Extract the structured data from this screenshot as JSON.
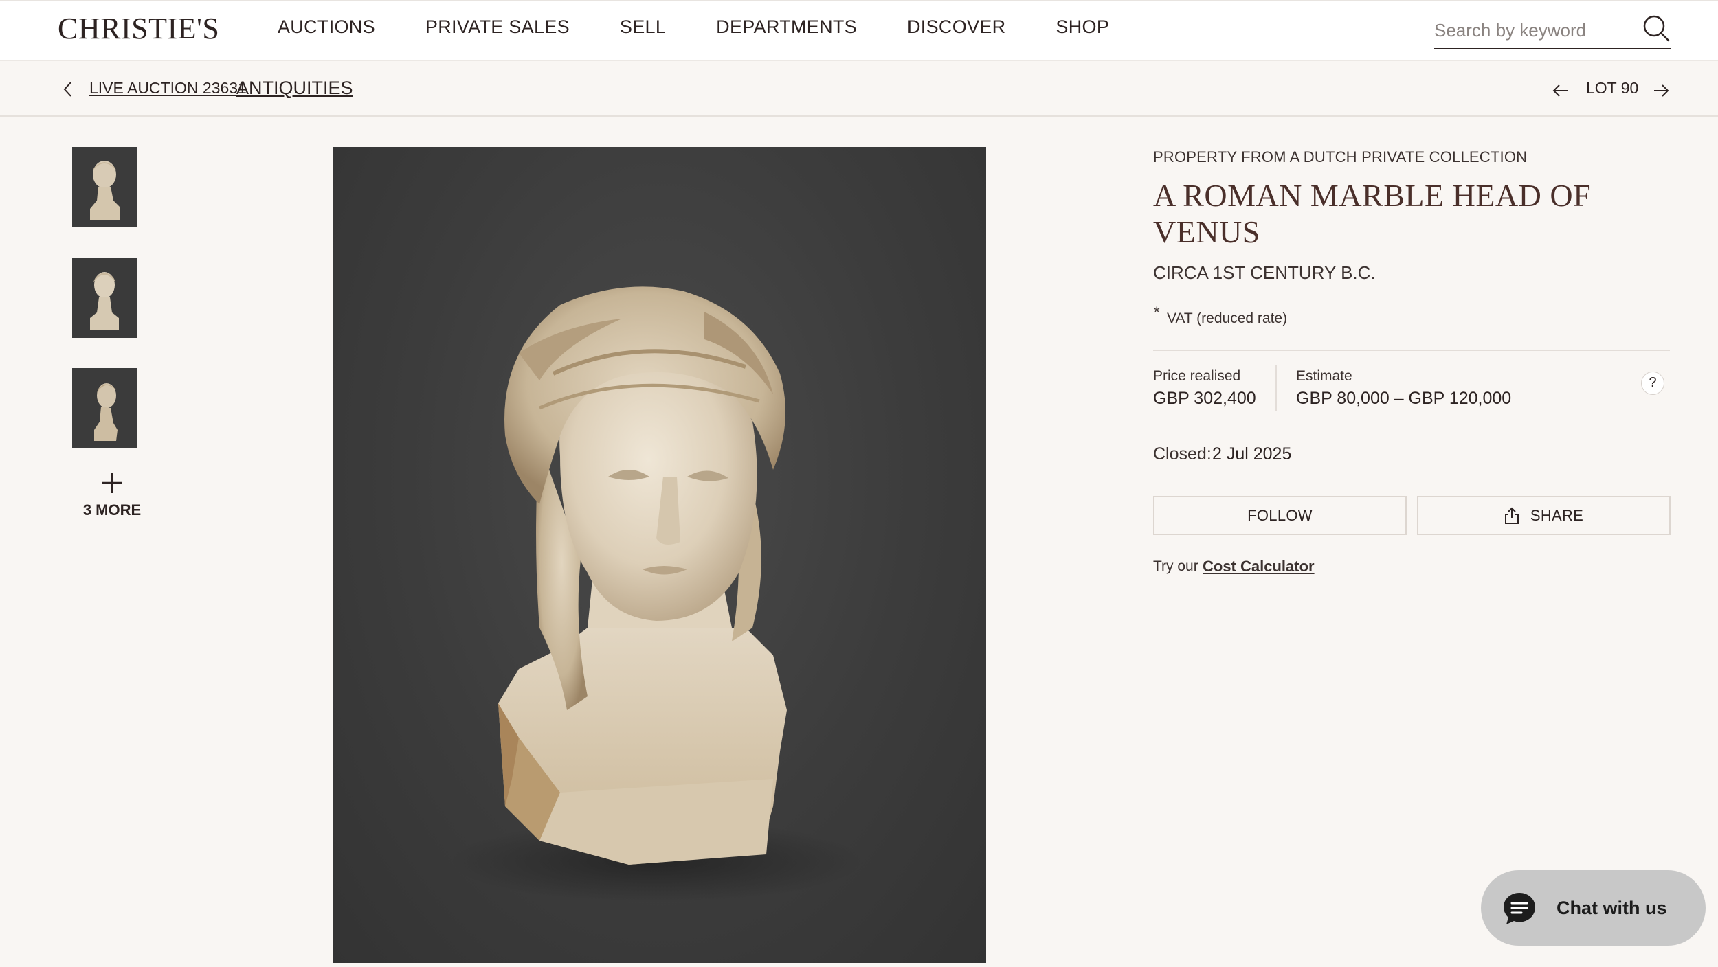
{
  "header": {
    "logo": "CHRISTIE'S",
    "nav": [
      "AUCTIONS",
      "PRIVATE SALES",
      "SELL",
      "DEPARTMENTS",
      "DISCOVER",
      "SHOP"
    ],
    "search": {
      "placeholder": "Search by keyword",
      "icon": "search-icon"
    }
  },
  "breadcrumb": {
    "auction": "LIVE AUCTION 23631",
    "department": "ANTIQUITIES"
  },
  "lot_nav": {
    "label": "LOT 90"
  },
  "gallery": {
    "thumbnail_count_shown": 3,
    "more_label": "3 MORE"
  },
  "lot": {
    "provenance": "PROPERTY FROM A DUTCH PRIVATE COLLECTION",
    "title": "A ROMAN MARBLE HEAD OF VENUS",
    "date": "CIRCA 1ST CENTURY B.C.",
    "vat_symbol": "*",
    "vat_note": "VAT (reduced rate)",
    "price_label": "Price realised",
    "price_value": "GBP 302,400",
    "estimate_label": "Estimate",
    "estimate_value": "GBP 80,000 – GBP 120,000",
    "help": "?",
    "closed_label": "Closed:",
    "closed_value": "2 Jul 2025"
  },
  "actions": {
    "follow": "FOLLOW",
    "share": "SHARE",
    "cost_prefix": "Try our",
    "cost_link": "Cost Calculator"
  },
  "chat": {
    "label": "Chat with us"
  },
  "colors": {
    "background": "#f9f6f3",
    "text": "#2d2322",
    "title": "#4a2f2a",
    "image_background": "#3c3c3c",
    "chat_bubble": "#c8c8c8"
  }
}
